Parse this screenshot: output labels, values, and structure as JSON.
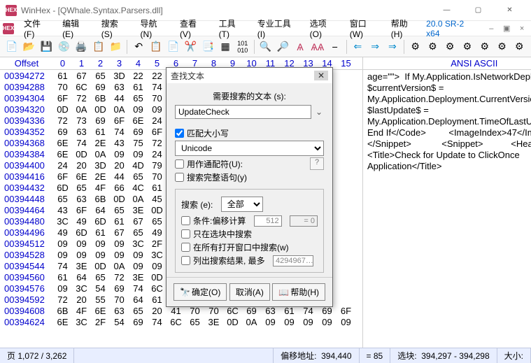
{
  "title": "WinHex - [QWhale.Syntax.Parsers.dll]",
  "version": "20.0 SR-2 x64",
  "menu": [
    "文件(F)",
    "编辑(E)",
    "搜索(S)",
    "导航(N)",
    "查看(V)",
    "工具(T)",
    "专业工具(I)",
    "选项(O)",
    "窗口(W)",
    "帮助(H)"
  ],
  "hex_header": {
    "offset": "Offset",
    "cols": [
      "0",
      "1",
      "2",
      "3",
      "4",
      "5",
      "6",
      "7",
      "8",
      "9",
      "10",
      "11",
      "12",
      "13",
      "14",
      "15"
    ],
    "ascii": "ANSI ASCII"
  },
  "rows": [
    {
      "off": "00394272",
      "b": [
        "61",
        "67",
        "65",
        "3D",
        "22",
        "22"
      ]
    },
    {
      "off": "00394288",
      "b": [
        "70",
        "6C",
        "69",
        "63",
        "61",
        "74"
      ]
    },
    {
      "off": "00394304",
      "b": [
        "6F",
        "72",
        "6B",
        "44",
        "65",
        "70"
      ]
    },
    {
      "off": "00394320",
      "b": [
        "0D",
        "0A",
        "0D",
        "0A",
        "09",
        "09"
      ]
    },
    {
      "off": "00394336",
      "b": [
        "72",
        "73",
        "69",
        "6F",
        "6E",
        "24"
      ]
    },
    {
      "off": "00394352",
      "b": [
        "69",
        "63",
        "61",
        "74",
        "69",
        "6F"
      ]
    },
    {
      "off": "00394368",
      "b": [
        "6E",
        "74",
        "2E",
        "43",
        "75",
        "72"
      ]
    },
    {
      "off": "00394384",
      "b": [
        "6E",
        "0D",
        "0A",
        "09",
        "09",
        "24"
      ]
    },
    {
      "off": "00394400",
      "b": [
        "24",
        "20",
        "3D",
        "20",
        "4D",
        "79"
      ]
    },
    {
      "off": "00394416",
      "b": [
        "6F",
        "6E",
        "2E",
        "44",
        "65",
        "70"
      ]
    },
    {
      "off": "00394432",
      "b": [
        "6D",
        "65",
        "4F",
        "66",
        "4C",
        "61"
      ]
    },
    {
      "off": "00394448",
      "b": [
        "65",
        "63",
        "6B",
        "0D",
        "0A",
        "45"
      ]
    },
    {
      "off": "00394464",
      "b": [
        "43",
        "6F",
        "64",
        "65",
        "3E",
        "0D"
      ]
    },
    {
      "off": "00394480",
      "b": [
        "3C",
        "49",
        "6D",
        "61",
        "67",
        "65"
      ]
    },
    {
      "off": "00394496",
      "b": [
        "49",
        "6D",
        "61",
        "67",
        "65",
        "49"
      ]
    },
    {
      "off": "00394512",
      "b": [
        "09",
        "09",
        "09",
        "09",
        "3C",
        "2F"
      ]
    },
    {
      "off": "00394528",
      "b": [
        "09",
        "09",
        "09",
        "09",
        "09",
        "3C"
      ]
    },
    {
      "off": "00394544",
      "b": [
        "74",
        "3E",
        "0D",
        "0A",
        "09",
        "09"
      ]
    },
    {
      "off": "00394560",
      "b": [
        "61",
        "64",
        "65",
        "72",
        "3E",
        "0D"
      ]
    },
    {
      "off": "00394576",
      "b": [
        "09",
        "3C",
        "54",
        "69",
        "74",
        "6C"
      ]
    },
    {
      "off": "00394592",
      "b": [
        "72",
        "20",
        "55",
        "70",
        "64",
        "61"
      ]
    },
    {
      "off": "00394608",
      "b": [
        "6B",
        "4F",
        "6E",
        "63",
        "65",
        "20",
        "41",
        "70",
        "70",
        "6C",
        "69",
        "63",
        "61",
        "74",
        "69",
        "6F"
      ]
    },
    {
      "off": "00394624",
      "b": [
        "6E",
        "3C",
        "2F",
        "54",
        "69",
        "74",
        "6C",
        "65",
        "3E",
        "0D",
        "0A",
        "09",
        "09",
        "09",
        "09",
        "09"
      ]
    }
  ],
  "row_tail": {
    "b7to15": [
      "41",
      "70",
      "",
      "70",
      "6C",
      "69",
      "63",
      "61",
      "74",
      "69",
      "6F"
    ]
  },
  "ascii_body": "age=\"\">  If My.Application.IsNetworkDeployed Then          $currentVersion$ = My.Application.Deployment.CurrentVersion       $lastUpdate$ = My.Application.Deployment.TimeOfLastUpdateCheck      End If</Code>         <ImageIndex>47</ImageIndex>     </Snippet>            <Snippet>           <Header>         <Title>Check for Update to ClickOnce Application</Title>",
  "status": {
    "page": "页 1,072 / 3,262",
    "offset_label": "偏移地址:",
    "offset": "394,440",
    "value": "= 85",
    "sel_label": "选块:",
    "sel": "394,297 - 394,298",
    "size_label": "大小:"
  },
  "dialog": {
    "title": "查找文本",
    "search_label": "需要搜索的文本 (s):",
    "search_value": "UpdateCheck",
    "match_case": "匹配大小写",
    "encoding": "Unicode",
    "wildcards": "用作通配符(U):",
    "whole_words": "搜索完整语句(y)",
    "scope_label": "搜索 (e):",
    "scope_value": "全部",
    "cond": "条件:偏移计算",
    "cond_val": "512",
    "cond_eq": "= 0",
    "only_block": "只在选块中搜索",
    "all_windows": "在所有打开窗口中搜索(w)",
    "list_hits": "列出搜索结果, 最多",
    "list_val": "4294967…",
    "ok": "确定(O)",
    "cancel": "取消(A)",
    "help": "帮助(H)"
  }
}
